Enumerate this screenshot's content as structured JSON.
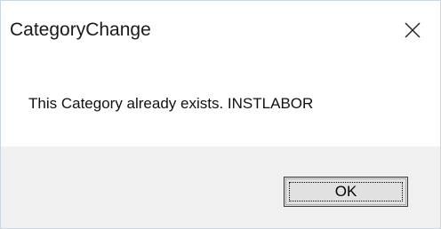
{
  "dialog": {
    "title": "CategoryChange",
    "close_icon": "close-icon",
    "message": "This Category already exists. INSTLABOR",
    "ok_label": "OK"
  },
  "colors": {
    "window_bg": "#ffffff",
    "footer_bg": "#f0f0f0",
    "border": "#c9d6e3",
    "button_bg": "#e1e1e1",
    "text": "#111111"
  }
}
